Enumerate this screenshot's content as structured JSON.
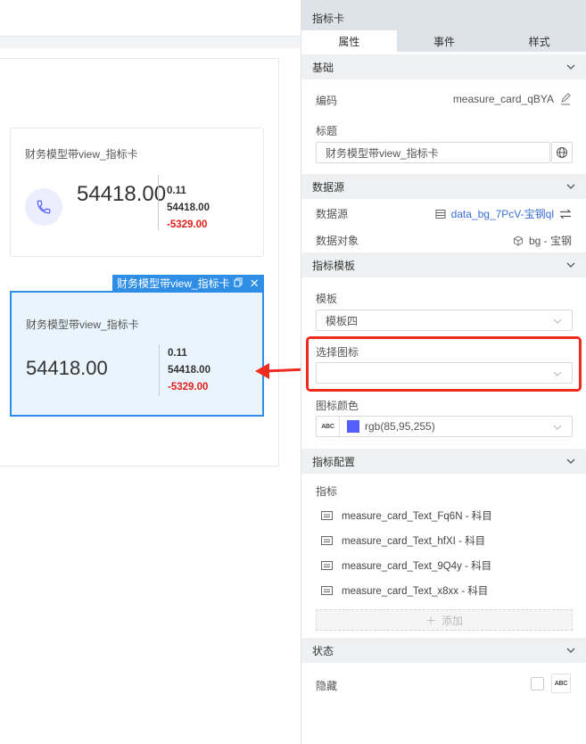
{
  "canvas": {
    "card1": {
      "title": "财务模型带view_指标卡",
      "value": "54418.00",
      "sub1": "0.11",
      "sub2": "54418.00",
      "sub3": "-5329.00"
    },
    "card2": {
      "title": "财务模型带view_指标卡",
      "value": "54418.00",
      "sub1": "0.11",
      "sub2": "54418.00",
      "sub3": "-5329.00"
    },
    "selected_tag": "财务模型带view_指标卡"
  },
  "side": {
    "title": "指标卡",
    "tabs": [
      "属性",
      "事件",
      "样式"
    ],
    "basic": {
      "section": "基础",
      "code_label": "编码",
      "code_value": "measure_card_qBYA",
      "title_label": "标题",
      "title_value": "财务模型带view_指标卡"
    },
    "datasource": {
      "section": "数据源",
      "ds_label": "数据源",
      "ds_value": "data_bg_7PcV-宝钢ql",
      "obj_label": "数据对象",
      "obj_value": "bg - 宝钢"
    },
    "template": {
      "section": "指标模板",
      "tpl_label": "模板",
      "tpl_value": "模板四",
      "icon_label": "选择图标",
      "icon_value": "",
      "color_label": "图标颜色",
      "color_value": "rgb(85,95,255)",
      "color_swatch": "#555fff",
      "abc": "ABC"
    },
    "config": {
      "section": "指标配置",
      "metrics_label": "指标",
      "items": [
        "measure_card_Text_Fq6N - 科目",
        "measure_card_Text_hfXI - 科目",
        "measure_card_Text_9Q4y - 科目",
        "measure_card_Text_x8xx - 科目"
      ],
      "add_label": "添加"
    },
    "state": {
      "section": "状态",
      "hide_label": "隐藏",
      "abc": "ABC"
    }
  },
  "colors": {
    "accent": "#2e8ee6",
    "highlight_red": "#ef2a20",
    "negative": "#e0211b",
    "link": "#3a6fd8"
  }
}
